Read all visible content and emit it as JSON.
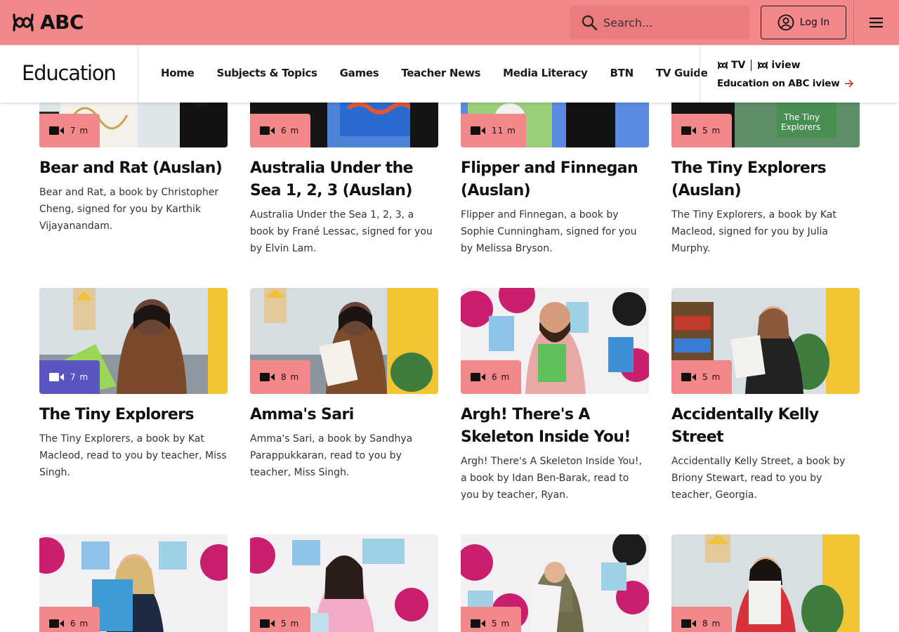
{
  "header": {
    "brand": "ABC",
    "search_placeholder": "Search...",
    "login_label": "Log In",
    "icons": {
      "search": "magnifier-icon",
      "user": "user-circle-icon",
      "menu": "hamburger-icon"
    }
  },
  "subnav": {
    "section_title": "Education",
    "links": [
      "Home",
      "Subjects & Topics",
      "Games",
      "Teacher News",
      "Media Literacy",
      "BTN",
      "TV Guide"
    ],
    "tv_logo": "TV",
    "iview_logo": "iview",
    "iview_link": "Education on ABC iview"
  },
  "colors": {
    "accent": "#f2888a",
    "active_badge": "#5b55c3"
  },
  "cards": [
    {
      "duration": "7 m",
      "title": "Bear and Rat (Auslan)",
      "desc": "Bear and Rat, a book by Christopher Cheng, signed for you by Karthik Vijayanandam."
    },
    {
      "duration": "6 m",
      "title": "Australia Under the Sea 1, 2, 3 (Auslan)",
      "desc": "Australia Under the Sea 1, 2, 3, a book by Frané Lessac, signed for you by Elvin Lam."
    },
    {
      "duration": "11 m",
      "title": "Flipper and Finnegan (Auslan)",
      "desc": "Flipper and Finnegan, a book by Sophie Cunningham, signed for you by Melissa Bryson."
    },
    {
      "duration": "5 m",
      "title": "The Tiny Explorers (Auslan)",
      "desc": "The Tiny Explorers, a book by Kat Macleod, signed for you by Julia Murphy."
    },
    {
      "duration": "7 m",
      "title": "The Tiny Explorers",
      "desc": "The Tiny Explorers, a book by Kat Macleod, read to you by teacher, Miss Singh."
    },
    {
      "duration": "8 m",
      "title": "Amma's Sari",
      "desc": "Amma's Sari, a book by Sandhya Parappukkaran, read to you by teacher, Miss Singh."
    },
    {
      "duration": "6 m",
      "title": "Argh! There's A Skeleton Inside You!",
      "desc": "Argh! There's A Skeleton Inside You!, a book by Idan Ben-Barak, read to you by teacher, Ryan."
    },
    {
      "duration": "5 m",
      "title": "Accidentally Kelly Street",
      "desc": "Accidentally Kelly Street, a book by Briony Stewart, read to you by teacher, Georgia."
    },
    {
      "duration": "6 m",
      "title": "",
      "desc": ""
    },
    {
      "duration": "5 m",
      "title": "",
      "desc": ""
    },
    {
      "duration": "5 m",
      "title": "",
      "desc": ""
    },
    {
      "duration": "8 m",
      "title": "",
      "desc": ""
    }
  ]
}
